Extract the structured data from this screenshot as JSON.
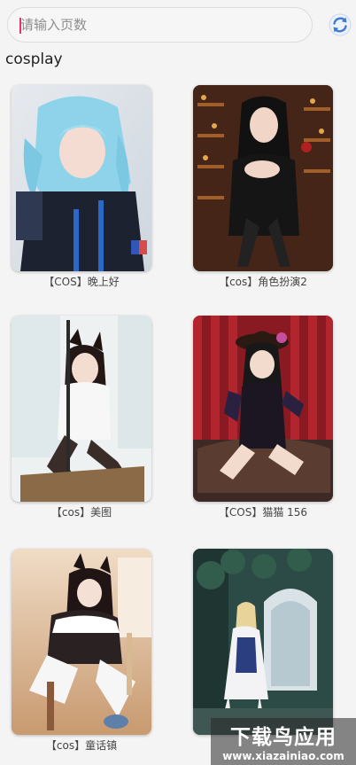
{
  "search": {
    "placeholder": "请输入页数",
    "value": ""
  },
  "section_title": "cosplay",
  "items": [
    {
      "caption": "【COS】晚上好"
    },
    {
      "caption": "【cos】角色扮演2"
    },
    {
      "caption": "【cos】美图"
    },
    {
      "caption": "【COS】猫猫 156"
    },
    {
      "caption": "【cos】童话镇"
    },
    {
      "caption": ""
    }
  ],
  "watermark": {
    "title": "下载鸟应用",
    "url": "www.xiazainiao.com"
  },
  "colors": {
    "accent": "#e0356a",
    "refresh_icon": "#3d7bd6"
  }
}
